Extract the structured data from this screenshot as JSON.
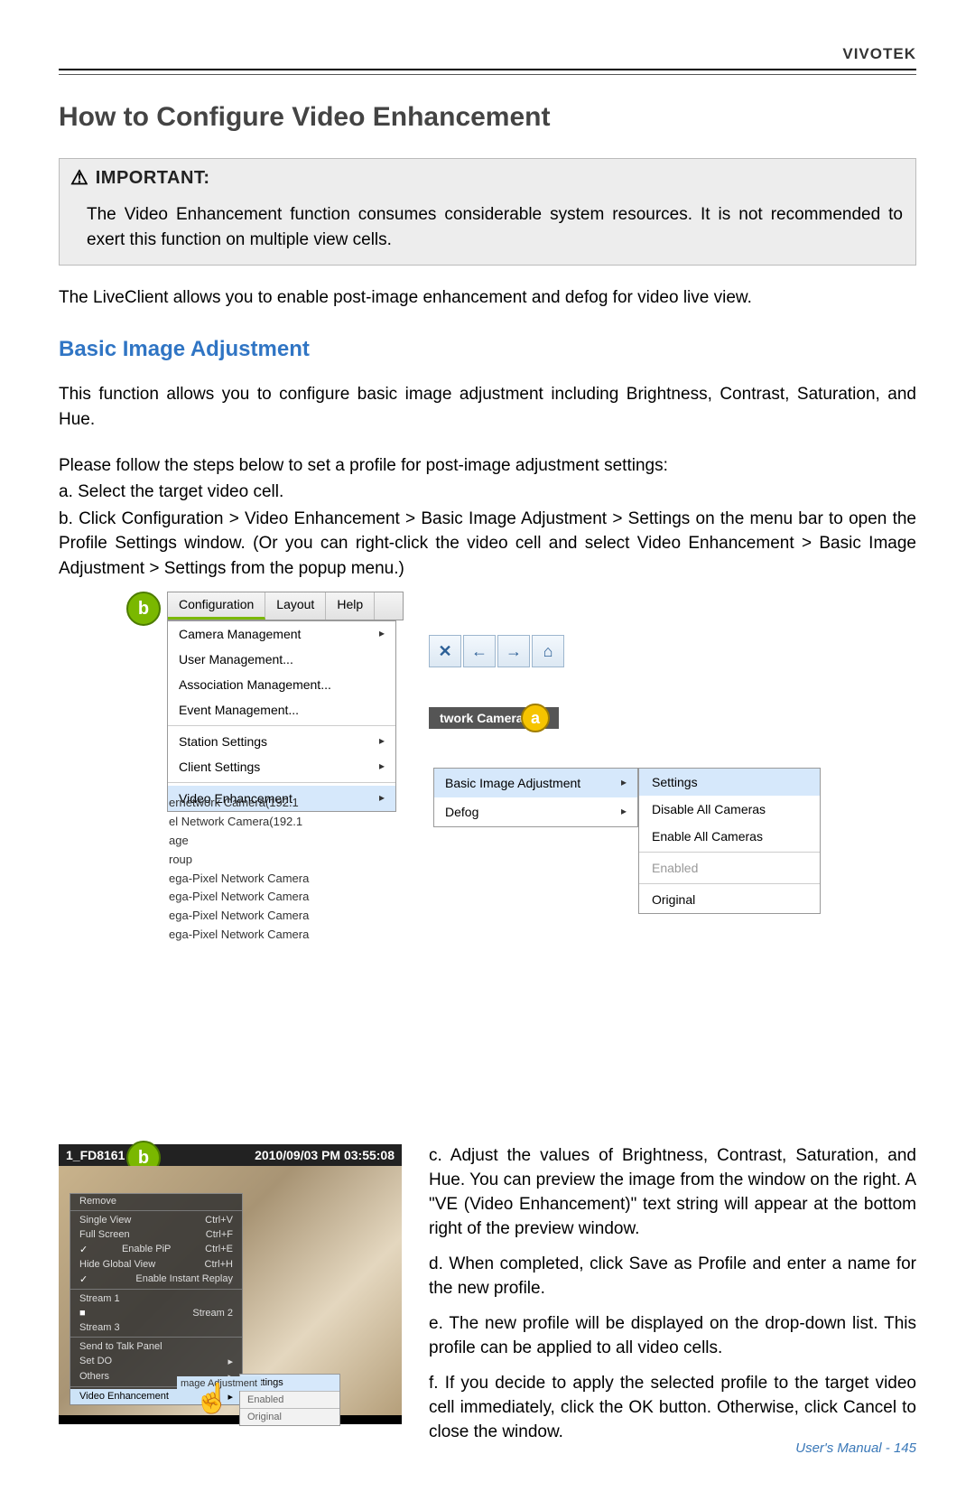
{
  "header": {
    "brand": "VIVOTEK"
  },
  "title": "How to Configure Video Enhancement",
  "important": {
    "label": "IMPORTANT:",
    "body": "The Video Enhancement function consumes considerable system resources. It is not recommended to exert this function on multiple view cells."
  },
  "para_intro": "The LiveClient allows you to enable post-image enhancement and defog for video live view.",
  "section_head": "Basic Image Adjustment",
  "para_func": "This function allows you to configure basic image adjustment including Brightness, Contrast, Saturation, and Hue.",
  "para_follow": "Please follow the steps below to set a profile for post-image adjustment settings:",
  "step_a": "a. Select the target video cell.",
  "step_b": "b. Click Configuration > Video Enhancement > Basic Image Adjustment > Settings on the menu bar to open the Profile Settings window. (Or you can right-click the video cell and select Video Enhancement > Basic Image Adjustment > Settings from the popup menu.)",
  "menu": {
    "tabs": {
      "config": "Configuration",
      "layout": "Layout",
      "help": "Help"
    },
    "items": {
      "cam": "Camera Management",
      "user": "User Management...",
      "assoc": "Association Management...",
      "event": "Event Management...",
      "station": "Station Settings",
      "client": "Client Settings",
      "ve": "Video Enhancement"
    }
  },
  "cam_label": "twork Camera",
  "sub": {
    "bia": "Basic Image Adjustment",
    "defog": "Defog"
  },
  "sub2": {
    "settings": "Settings",
    "disable": "Disable All Cameras",
    "enable": "Enable All Cameras",
    "enabled": "Enabled",
    "original": "Original"
  },
  "tree": {
    "l1": "ernetwork Camera(192.1",
    "l2": "el Network Camera(192.1",
    "l3": "age",
    "l4": "roup",
    "l5": "ega-Pixel Network Camera",
    "l6": "ega-Pixel Network Camera",
    "l7": "ega-Pixel Network Camera",
    "l8": "ega-Pixel Network Camera"
  },
  "thumb": {
    "id": "1_FD8161",
    "ts": "2010/09/03 PM 03:55:08"
  },
  "ctx": {
    "remove": "Remove",
    "single": "Single View",
    "single_k": "Ctrl+V",
    "full": "Full Screen",
    "full_k": "Ctrl+F",
    "pip": "Enable PiP",
    "pip_k": "Ctrl+E",
    "hide": "Hide Global View",
    "hide_k": "Ctrl+H",
    "replay": "Enable Instant Replay",
    "s1": "Stream 1",
    "s2": "Stream 2",
    "s3": "Stream 3",
    "talk": "Send to Talk Panel",
    "setdo": "Set DO",
    "others": "Others",
    "ve": "Video Enhancement"
  },
  "mini": {
    "adj": "mage Adjustment",
    "settings": "Settings",
    "enabled": "Enabled",
    "original": "Original"
  },
  "rs": {
    "c": "c. Adjust the values of Brightness, Contrast, Saturation, and Hue. You can preview the image from the window on the right. A \"VE (Video Enhancement)\" text string will appear at the bottom right of the preview window.",
    "d": "d. When completed, click Save as Profile and enter a name for the new profile.",
    "e": "e. The new profile will be displayed on the drop-down list. This profile can be applied to all video cells.",
    "f": "f. If you decide to apply the selected profile to the target video cell immediately, click the OK button. Otherwise, click Cancel to close the window."
  },
  "foot": "User's Manual - 145"
}
